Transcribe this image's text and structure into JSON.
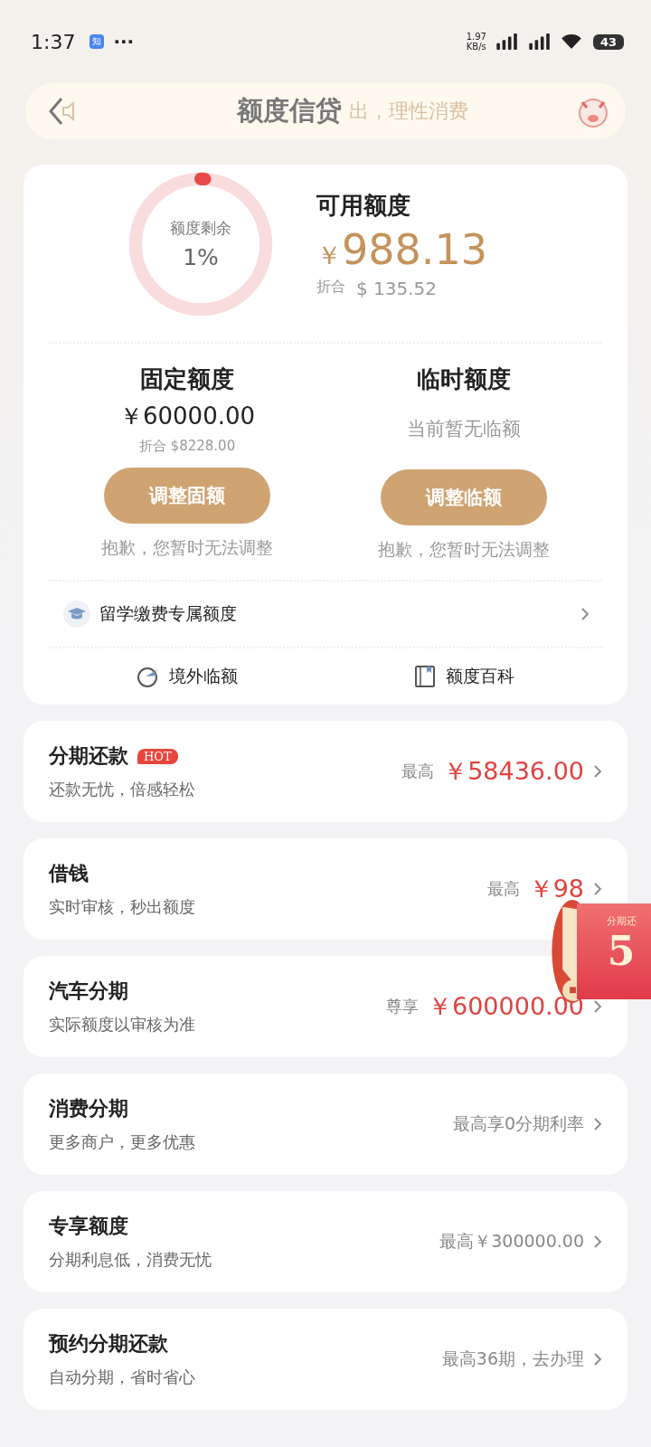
{
  "status_bar": {
    "time": "1:37",
    "app_badge": "知",
    "more": "···",
    "net_speed": [
      "1.97",
      "KB/s"
    ],
    "battery": "43"
  },
  "header": {
    "title": "额度信贷",
    "notice": "出，理性消费"
  },
  "quota": {
    "ring_label": "额度剩余",
    "ring_percent": "1%",
    "level": 0.01,
    "available_label": "可用额度",
    "currency": "￥",
    "available": "988.13",
    "converted_label": "折合",
    "converted": "$ 135.52",
    "columns": [
      {
        "title": "固定额度",
        "amount": "￥60000.00",
        "converted": "折合 $8228.00",
        "button": "调整固额",
        "note": "抱歉，您暂时无法调整"
      },
      {
        "title": "临时额度",
        "empty": "当前暂无临额",
        "button": "调整临额",
        "note": "抱歉，您暂时无法调整"
      }
    ],
    "special": "留学缴费专属额度",
    "links": [
      {
        "kind": "plane",
        "label": "境外临额"
      },
      {
        "kind": "book",
        "label": "额度百科"
      }
    ]
  },
  "products": [
    {
      "title": "分期还款",
      "badge": "HOT",
      "subtitle": "还款无忧，倍感轻松",
      "prefix": "最高",
      "value": "￥58436.00",
      "kind": "amount"
    },
    {
      "title": "借钱",
      "subtitle": "实时审核，秒出额度",
      "prefix": "最高",
      "value": "￥98",
      "kind": "amount"
    },
    {
      "title": "汽车分期",
      "subtitle": "实际额度以审核为准",
      "prefix": "尊享",
      "value": "￥600000.00",
      "kind": "amount"
    },
    {
      "title": "消费分期",
      "subtitle": "更多商户，更多优惠",
      "value": "最高享0分期利率",
      "kind": "note"
    },
    {
      "title": "专享额度",
      "subtitle": "分期利息低，消费无忧",
      "value": "最高￥300000.00",
      "kind": "note"
    },
    {
      "title": "预约分期还款",
      "subtitle": "自动分期，省时省心",
      "value": "最高36期，去办理",
      "kind": "note"
    }
  ],
  "promo": {
    "caption": "分期还",
    "number": "5"
  }
}
